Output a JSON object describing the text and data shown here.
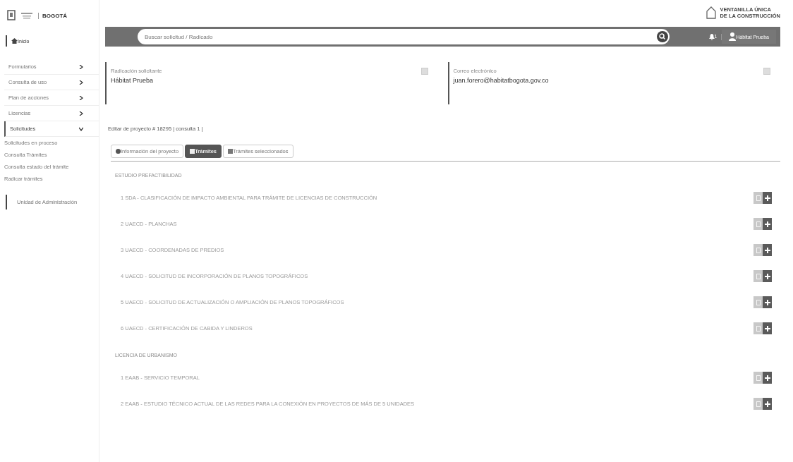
{
  "header": {
    "city": "BOGOTÁ",
    "portal": [
      "VENTANILLA ÚNICA",
      "DE LA CONSTRUCCIÓN"
    ]
  },
  "sidebar": {
    "home": "Inicio",
    "items": [
      {
        "label": "Formularios",
        "expanded": false
      },
      {
        "label": "Consulta de uso",
        "expanded": false
      },
      {
        "label": "Plan de acciones",
        "expanded": false
      },
      {
        "label": "Licencias",
        "expanded": false
      },
      {
        "label": "Solicitudes",
        "expanded": true,
        "children": [
          {
            "label": "Solicitudes en proceso"
          },
          {
            "label": "Consulta Trámites"
          },
          {
            "label": "Consulta estado del trámite"
          },
          {
            "label": "Radicar trámites"
          }
        ]
      }
    ],
    "footer": "Unidad de Administración"
  },
  "topbar": {
    "search": {
      "placeholder": "Buscar solicitud / Radicado"
    },
    "notifications": "1",
    "user": "Hábitat Prueba"
  },
  "cards": [
    {
      "label": "Radicación solicitante",
      "value": "Hábitat Prueba"
    },
    {
      "label": "Correo electrónico",
      "value": "juan.forero@habitatbogota.gov.co"
    }
  ],
  "project_title": "Editar de proyecto # 18295 | consulta 1 |",
  "tabs": [
    {
      "label": "Información del proyecto",
      "selected": false
    },
    {
      "label": "Trámites",
      "selected": true
    },
    {
      "label": "Trámites seleccionados",
      "selected": false
    }
  ],
  "sections": [
    {
      "title": "ESTUDIO PREFACTIBILIDAD",
      "items": [
        "1 SDA - CLASIFICACIÓN DE IMPACTO AMBIENTAL PARA TRÁMITE DE LICENCIAS DE CONSTRUCCIÓN",
        "2 UAECD - PLANCHAS",
        "3 UAECD - COORDENADAS DE PREDIOS",
        "4 UAECD - SOLICITUD DE INCORPORACIÓN DE PLANOS TOPOGRÁFICOS",
        "5 UAECD - SOLICITUD DE ACTUALIZACIÓN O AMPLIACIÓN DE PLANOS TOPOGRÁFICOS",
        "6 UAECD - CERTIFICACIÓN DE CABIDA Y LINDEROS"
      ]
    },
    {
      "title": "LICENCIA DE URBANISMO",
      "items": [
        "1 EAAB - SERVICIO TEMPORAL",
        "2 EAAB - ESTUDIO TÉCNICO ACTUAL DE LAS REDES PARA LA CONEXIÓN EN PROYECTOS DE MÁS DE 5 UNIDADES"
      ]
    }
  ]
}
